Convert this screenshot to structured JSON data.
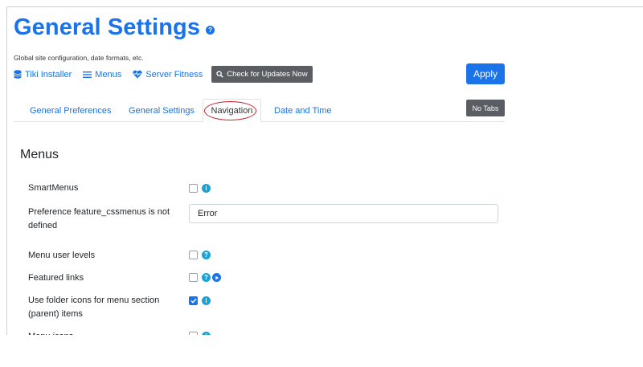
{
  "header": {
    "title": "General Settings",
    "help_glyph": "?",
    "subtitle": "Global site configuration, date formats, etc."
  },
  "toolbar": {
    "links": [
      {
        "label": "Tiki Installer",
        "icon": "database-icon"
      },
      {
        "label": "Menus",
        "icon": "bars-icon"
      },
      {
        "label": "Server Fitness",
        "icon": "heartbeat-icon"
      }
    ],
    "check_updates_label": "Check for Updates Now",
    "apply_label": "Apply"
  },
  "tabs": [
    {
      "label": "General Preferences",
      "active": false
    },
    {
      "label": "General Settings",
      "active": false
    },
    {
      "label": "Navigation",
      "active": true
    },
    {
      "label": "Date and Time",
      "active": false
    }
  ],
  "no_tabs_label": "No Tabs",
  "section": {
    "title": "Menus",
    "preferences": [
      {
        "label": "SmartMenus",
        "control": "checkbox",
        "checked": false,
        "icons": [
          "info-icon"
        ]
      },
      {
        "label": "Preference feature_cssmenus is not defined",
        "control": "text",
        "value": "Error"
      },
      {
        "label": "Menu user levels",
        "control": "checkbox",
        "checked": false,
        "icons": [
          "help-icon"
        ]
      },
      {
        "label": "Featured links",
        "control": "checkbox",
        "checked": false,
        "icons": [
          "help-icon",
          "play-icon"
        ]
      },
      {
        "label": "Use folder icons for menu section (parent) items",
        "control": "checkbox",
        "checked": true,
        "icons": [
          "info-icon"
        ]
      },
      {
        "label": "Menu icons",
        "control": "checkbox",
        "checked": false,
        "icons": [
          "info-icon"
        ]
      }
    ]
  },
  "glyphs": {
    "info": "i",
    "help": "?"
  },
  "colors": {
    "accent": "#1a73e8",
    "info": "#17a2d8",
    "secondary_button": "#5a5e63",
    "highlight_circle": "#c8202e"
  }
}
